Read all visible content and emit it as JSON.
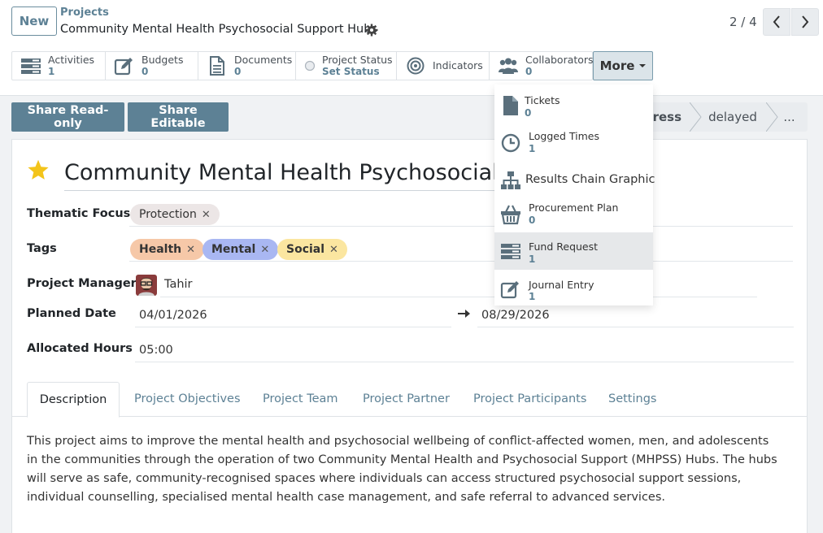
{
  "control_panel": {
    "new_label": "New",
    "breadcrumb_parent": "Projects",
    "breadcrumb_current": "Community Mental Health Psychosocial Support Hubs",
    "pager": "2 / 4"
  },
  "stat_buttons": [
    {
      "label": "Activities",
      "value": "1"
    },
    {
      "label": "Budgets",
      "value": "0"
    },
    {
      "label": "Documents",
      "value": "0"
    },
    {
      "label": "Project Status",
      "value": "Set Status"
    },
    {
      "label": "Indicators",
      "value": ""
    },
    {
      "label": "Collaborators",
      "value": "0"
    }
  ],
  "more_label": "More",
  "more_menu": [
    {
      "label": "Tickets",
      "value": "0"
    },
    {
      "label": "Logged Times",
      "value": "1"
    },
    {
      "label": "Results Chain Graphic",
      "value": ""
    },
    {
      "label": "Procurement Plan",
      "value": "0"
    },
    {
      "label": "Fund Request",
      "value": "1"
    },
    {
      "label": "Journal Entry",
      "value": "1"
    }
  ],
  "actions": {
    "share_readonly": "Share Read-only",
    "share_editable": "Share Editable"
  },
  "stages": [
    "gress",
    "delayed",
    "..."
  ],
  "form": {
    "title": "Community Mental Health Psychosocial Support Hubs",
    "labels": {
      "thematic_focus": "Thematic Focus",
      "tags": "Tags",
      "project_manager": "Project Manager",
      "planned_date": "Planned Date",
      "allocated_hours": "Allocated Hours"
    },
    "thematic_focus": [
      "Protection"
    ],
    "tags": [
      "Health",
      "Mental",
      "Social"
    ],
    "project_manager": "Tahir",
    "planned_start": "04/01/2026",
    "planned_end": "08/29/2026",
    "allocated_hours": "05:00"
  },
  "tabs": [
    "Description",
    "Project Objectives",
    "Project Team",
    "Project Partner",
    "Project Participants",
    "Settings"
  ],
  "description": "This project aims to improve the mental health and psychosocial wellbeing of conflict-affected women, men, and adolescents in the communities through the operation of two Community Mental Health and Psychosocial Support (MHPSS) Hubs. The hubs will serve as safe, community-recognised spaces where individuals can access structured psychosocial support sessions, individual counselling, specialised mental health case management, and safe referral to advanced services.",
  "colors": {
    "primary": "#5d8195",
    "star": "#f3c41a",
    "tag_health": "#f6c8a8",
    "tag_mental": "#a9b7f2",
    "tag_social": "#fbe6a0"
  }
}
